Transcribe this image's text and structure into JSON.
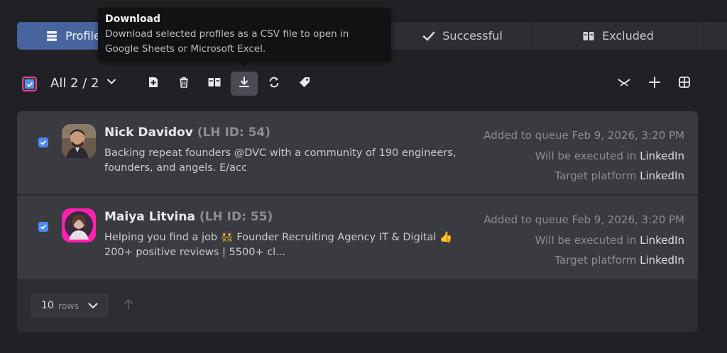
{
  "tabs": {
    "profiles": "Profiles",
    "successful": "Successful",
    "excluded": "Excluded"
  },
  "toolbar": {
    "selection": "All 2 / 2",
    "icons": [
      "add-to-list-icon",
      "delete-icon",
      "exclude-icon",
      "download-icon",
      "sync-icon",
      "tag-icon",
      "collapse-icon",
      "plus-icon",
      "grid-icon"
    ]
  },
  "tooltip": {
    "title": "Download",
    "body_line1": "Download selected profiles as a CSV file to open in",
    "body_line2": "Google Sheets or Microsoft Excel."
  },
  "profiles": [
    {
      "name": "Nick Davidov",
      "lh_id": "(LH ID: 54)",
      "headline_line1": "Backing repeat founders @DVC with a community of 190 engineers,",
      "headline_line2": "founders, and angels. E/acc",
      "added_label": "Added to queue Feb 9, 2026, 3:20 PM",
      "executed_label": "Will be executed in",
      "executed_value": "LinkedIn",
      "target_label": "Target platform",
      "target_value": "LinkedIn",
      "checked": true
    },
    {
      "name": "Maiya Litvina",
      "lh_id": "(LH ID: 55)",
      "headline_line1": "Helping you find a job 👯 Founder Recruiting Agency IT & Digital 👍",
      "headline_line2": "200+ positive reviews | 5500+ cl...",
      "added_label": "Added to queue Feb 9, 2026, 3:20 PM",
      "executed_label": "Will be executed in",
      "executed_value": "LinkedIn",
      "target_label": "Target platform",
      "target_value": "LinkedIn",
      "checked": true
    }
  ],
  "pagination": {
    "rows_count": "10",
    "rows_unit": "rows"
  },
  "colors": {
    "accent": "#48649f",
    "checkbox": "#4a8af4",
    "background": "#212125"
  }
}
